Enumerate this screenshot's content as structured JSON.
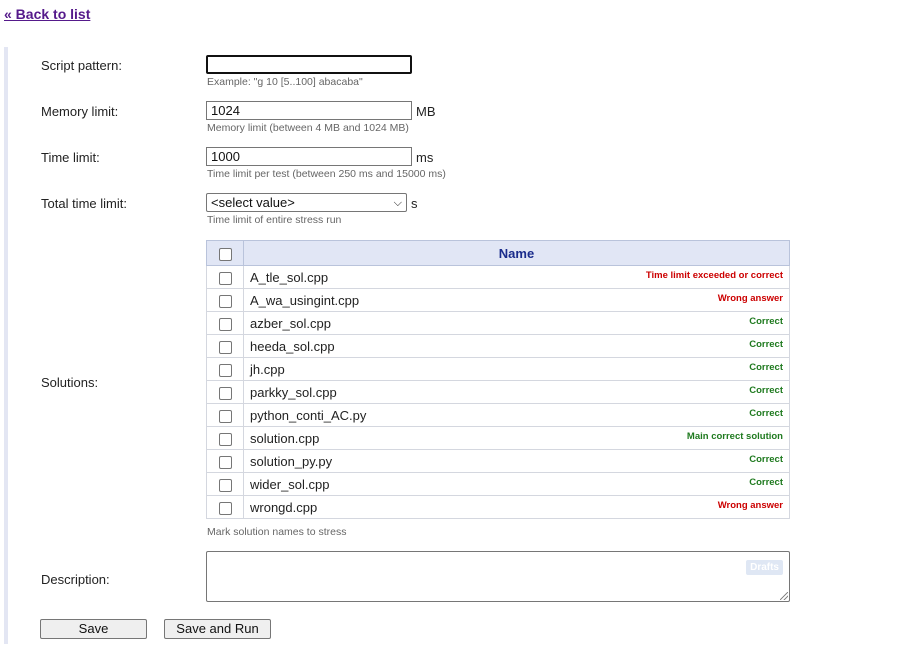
{
  "nav": {
    "back_label": "« Back to list"
  },
  "script_pattern": {
    "label": "Script pattern:",
    "value": "",
    "hint": "Example: \"g 10 [5..100] abacaba\""
  },
  "memory_limit": {
    "label": "Memory limit:",
    "value": "1024",
    "unit": "MB",
    "hint": "Memory limit (between 4 MB and 1024 MB)"
  },
  "time_limit": {
    "label": "Time limit:",
    "value": "1000",
    "unit": "ms",
    "hint": "Time limit per test (between 250 ms and 15000 ms)"
  },
  "total_time_limit": {
    "label": "Total time limit:",
    "selected": "<select value>",
    "unit": "s",
    "hint": "Time limit of entire stress run"
  },
  "solutions": {
    "label": "Solutions:",
    "header_name": "Name",
    "hint": "Mark solution names to stress",
    "rows": [
      {
        "name": "A_tle_sol.cpp",
        "verdict": "Time limit exceeded or correct",
        "verdict_color": "#cc0000"
      },
      {
        "name": "A_wa_usingint.cpp",
        "verdict": "Wrong answer",
        "verdict_color": "#cc0000"
      },
      {
        "name": "azber_sol.cpp",
        "verdict": "Correct",
        "verdict_color": "#1f7a1f"
      },
      {
        "name": "heeda_sol.cpp",
        "verdict": "Correct",
        "verdict_color": "#1f7a1f"
      },
      {
        "name": "jh.cpp",
        "verdict": "Correct",
        "verdict_color": "#1f7a1f"
      },
      {
        "name": "parkky_sol.cpp",
        "verdict": "Correct",
        "verdict_color": "#1f7a1f"
      },
      {
        "name": "python_conti_AC.py",
        "verdict": "Correct",
        "verdict_color": "#1f7a1f"
      },
      {
        "name": "solution.cpp",
        "verdict": "Main correct solution",
        "verdict_color": "#1f7a1f"
      },
      {
        "name": "solution_py.py",
        "verdict": "Correct",
        "verdict_color": "#1f7a1f"
      },
      {
        "name": "wider_sol.cpp",
        "verdict": "Correct",
        "verdict_color": "#1f7a1f"
      },
      {
        "name": "wrongd.cpp",
        "verdict": "Wrong answer",
        "verdict_color": "#cc0000"
      }
    ]
  },
  "description": {
    "label": "Description:",
    "drafts_label": "Drafts"
  },
  "buttons": {
    "save": "Save",
    "save_and_run": "Save and Run"
  }
}
